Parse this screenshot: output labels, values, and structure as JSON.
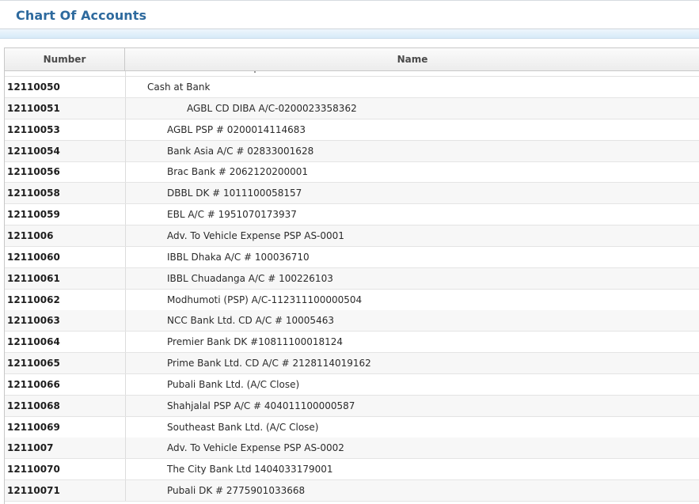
{
  "page": {
    "title": "Chart Of Accounts"
  },
  "grid": {
    "columns": {
      "number": "Number",
      "name": "Name"
    },
    "rows": [
      {
        "number": "12110050",
        "name": "Cash at Bank",
        "level": 0
      },
      {
        "number": "12110051",
        "name": "AGBL CD DIBA A/C-0200023358362",
        "level": 2
      },
      {
        "number": "12110053",
        "name": "AGBL PSP # 0200014114683",
        "level": 1
      },
      {
        "number": "12110054",
        "name": "Bank Asia A/C # 02833001628",
        "level": 1
      },
      {
        "number": "12110056",
        "name": "Brac Bank # 2062120200001",
        "level": 1
      },
      {
        "number": "12110058",
        "name": "DBBL DK # 1011100058157",
        "level": 1
      },
      {
        "number": "12110059",
        "name": "EBL A/C # 1951070173937",
        "level": 1
      },
      {
        "number": "1211006",
        "name": "Adv. To Vehicle Expense PSP AS-0001",
        "level": 1
      },
      {
        "number": "12110060",
        "name": "IBBL Dhaka A/C # 100036710",
        "level": 1
      },
      {
        "number": "12110061",
        "name": "IBBL Chuadanga A/C # 100226103",
        "level": 1
      },
      {
        "number": "12110062",
        "name": "Modhumoti (PSP) A/C-112311100000504",
        "level": 1
      },
      {
        "number": "12110063",
        "name": "NCC Bank Ltd. CD A/C # 10005463",
        "level": 1
      },
      {
        "number": "12110064",
        "name": "Premier Bank DK #10811100018124",
        "level": 1
      },
      {
        "number": "12110065",
        "name": "Prime Bank Ltd. CD A/C # 2128114019162",
        "level": 1
      },
      {
        "number": "12110066",
        "name": "Pubali Bank Ltd. (A/C Close)",
        "level": 1
      },
      {
        "number": "12110068",
        "name": "Shahjalal PSP A/C # 404011100000587",
        "level": 1
      },
      {
        "number": "12110069",
        "name": "Southeast Bank Ltd. (A/C Close)",
        "level": 1
      },
      {
        "number": "1211007",
        "name": "Adv. To Vehicle Expense PSP AS-0002",
        "level": 1
      },
      {
        "number": "12110070",
        "name": "The City Bank Ltd 1404033179001",
        "level": 1
      },
      {
        "number": "12110071",
        "name": "Pubali DK # 2775901033668",
        "level": 1
      }
    ]
  },
  "colors": {
    "title": "#2e6a9e",
    "alt_row": "#f7f7f7",
    "grid_line": "#c8c8c8"
  }
}
